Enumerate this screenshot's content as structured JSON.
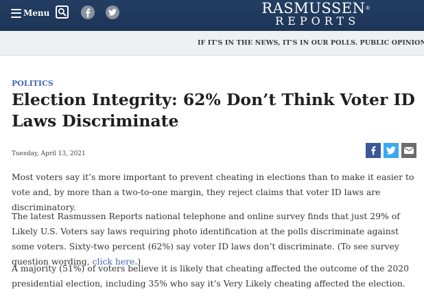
{
  "header": {
    "menu_label": "Menu",
    "brand_top": "RASMUSSEN",
    "brand_tm": "®",
    "brand_bottom": "REPORTS",
    "bg_color": "#1d3557"
  },
  "ticker": {
    "text": "IF IT'S IN THE NEWS, IT'S IN OUR POLLS. PUBLIC OPINION POLLING SI"
  },
  "article": {
    "category": "POLITICS",
    "headline": "Election Integrity: 62% Don’t Think Voter ID Laws Discriminate",
    "date": "Tuesday, April 13, 2021",
    "paragraphs": {
      "p1": "Most voters say it’s more important to prevent cheating in elections than to make it easier to vote and, by more than a two-to-one margin, they reject claims that voter ID laws are discriminatory.",
      "p2_text": "The latest Rasmussen Reports national telephone and online survey finds that just 29% of Likely U.S. Voters say laws requiring photo identification at the polls discriminate against some voters. Sixty-two percent (62%) say voter ID laws don’t discriminate. (To see survey question wording, ",
      "p2_link": "click here",
      "p2_end": ".)",
      "p3": "A majority (51%) of voters believe it is likely that cheating affected the outcome of the 2020 presidential election, including 35% who say it’s Very Likely cheating affected the election."
    }
  },
  "icons": {
    "menu": "hamburger-icon",
    "search": "search-icon",
    "facebook": "facebook-icon",
    "twitter": "twitter-icon",
    "email": "email-icon"
  },
  "colors": {
    "accent_link": "#3f66b8",
    "facebook": "#3b5998",
    "twitter": "#3ba9ee",
    "email": "#6b6b6b"
  }
}
